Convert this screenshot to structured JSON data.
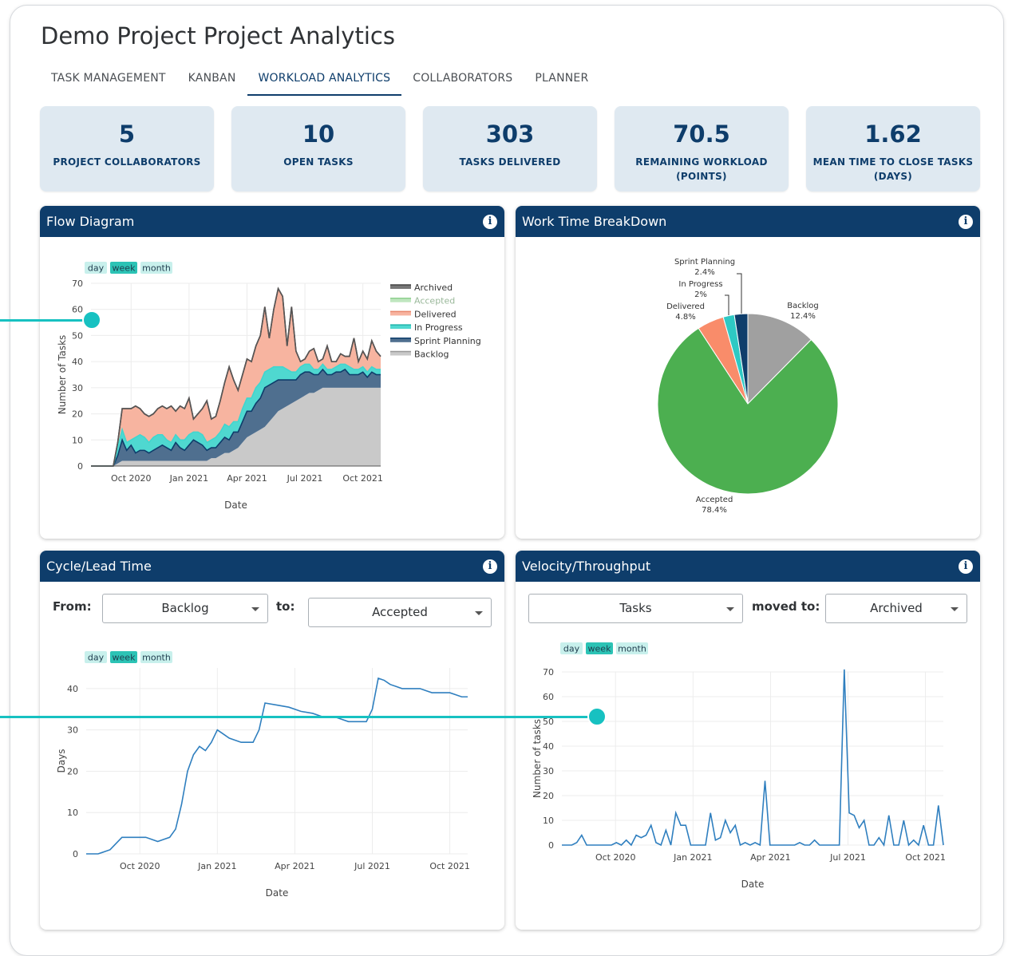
{
  "page": {
    "title": "Demo Project Project Analytics"
  },
  "tabs": [
    {
      "label": "TASK MANAGEMENT",
      "active": false
    },
    {
      "label": "KANBAN",
      "active": false
    },
    {
      "label": "WORKLOAD ANALYTICS",
      "active": true
    },
    {
      "label": "COLLABORATORS",
      "active": false
    },
    {
      "label": "PLANNER",
      "active": false
    }
  ],
  "kpis": [
    {
      "value": "5",
      "label_line1": "PROJECT COLLABORATORS",
      "label_line2": ""
    },
    {
      "value": "10",
      "label_line1": "OPEN TASKS",
      "label_line2": ""
    },
    {
      "value": "303",
      "label_line1": "TASKS DELIVERED",
      "label_line2": ""
    },
    {
      "value": "70.5",
      "label_line1": "REMAINING WORKLOAD",
      "label_line2": "(POINTS)"
    },
    {
      "value": "1.62",
      "label_line1": "MEAN TIME TO CLOSE TASKS",
      "label_line2": "(DAYS)"
    }
  ],
  "colors": {
    "brand": "#0e3d6b",
    "kpi_bg": "#dfe9f1",
    "line": "#2f7fbf",
    "overlay": "#17c1c1",
    "archived": "#555555",
    "accepted": "#4caf50",
    "delivered": "#f9a58e",
    "in_progress": "#40d6cf",
    "sprint_planning": "#0e3d6b",
    "backlog": "#c8c8c8"
  },
  "range_buttons": [
    "day",
    "week",
    "month"
  ],
  "panels": {
    "flow": {
      "title": "Flow Diagram",
      "info": "i"
    },
    "work": {
      "title": "Work Time BreakDown",
      "info": "i"
    },
    "cycle": {
      "title": "Cycle/Lead Time",
      "info": "i",
      "from_label": "From:",
      "from_value": "Backlog",
      "to_label": "to:",
      "to_value": "Accepted"
    },
    "velocity": {
      "title": "Velocity/Throughput",
      "info": "i",
      "metric_value": "Tasks",
      "moved_label": "moved to:",
      "moved_value": "Archived"
    }
  },
  "chart_data": [
    {
      "id": "flow",
      "type": "area",
      "xlabel": "Date",
      "ylabel": "Number of Tasks",
      "ylim": [
        0,
        70
      ],
      "yticks": [
        0,
        10,
        20,
        30,
        40,
        50,
        60,
        70
      ],
      "xticks": [
        "Oct 2020",
        "Jan 2021",
        "Apr 2021",
        "Jul 2021",
        "Oct 2021"
      ],
      "xtick_weeks": [
        9,
        22,
        35,
        48,
        61
      ],
      "range_selected": "week",
      "legend": [
        "Archived",
        "Accepted",
        "Delivered",
        "In Progress",
        "Sprint Planning",
        "Backlog"
      ],
      "legend_position": "right",
      "series": [
        {
          "name": "Backlog",
          "values": [
            0,
            0,
            0,
            0,
            0,
            0,
            1,
            2,
            2,
            2,
            2,
            2,
            2,
            2,
            2,
            2,
            2,
            2,
            2,
            2,
            2,
            2,
            2,
            2,
            2,
            2,
            2,
            3,
            3,
            4,
            5,
            5,
            6,
            7,
            9,
            11,
            12,
            13,
            14,
            15,
            17,
            19,
            21,
            22,
            23,
            24,
            25,
            26,
            27,
            28,
            28,
            29,
            30,
            30,
            30,
            30,
            30,
            30,
            30,
            30,
            30,
            30,
            30,
            30,
            30,
            30
          ]
        },
        {
          "name": "Sprint Planning",
          "values": [
            0,
            0,
            0,
            0,
            0,
            0,
            3,
            8,
            4,
            6,
            3,
            4,
            4,
            3,
            4,
            5,
            6,
            5,
            4,
            7,
            5,
            4,
            6,
            8,
            7,
            6,
            4,
            4,
            4,
            5,
            6,
            5,
            7,
            6,
            8,
            10,
            9,
            11,
            12,
            15,
            14,
            13,
            12,
            11,
            10,
            9,
            8,
            9,
            9,
            8,
            7,
            6,
            7,
            5,
            5,
            6,
            6,
            7,
            5,
            5,
            5,
            6,
            4,
            6,
            5,
            5
          ]
        },
        {
          "name": "In Progress",
          "values": [
            0,
            0,
            0,
            0,
            0,
            0,
            3,
            4,
            3,
            2,
            6,
            6,
            5,
            4,
            5,
            5,
            4,
            3,
            3,
            3,
            3,
            4,
            4,
            3,
            4,
            4,
            3,
            3,
            4,
            4,
            5,
            5,
            4,
            4,
            5,
            5,
            5,
            6,
            6,
            6,
            6,
            6,
            5,
            5,
            4,
            3,
            3,
            3,
            3,
            3,
            2,
            2,
            2,
            2,
            2,
            2,
            3,
            2,
            3,
            2,
            2,
            2,
            2,
            2,
            2,
            2
          ]
        },
        {
          "name": "Accepted",
          "values": [
            0,
            0,
            0,
            0,
            0,
            0,
            0,
            0,
            0,
            0,
            0,
            0,
            0,
            0,
            0,
            0,
            0,
            0,
            0,
            0,
            0,
            0,
            0,
            0,
            0,
            0,
            0,
            0,
            0,
            0,
            0,
            0,
            0,
            0,
            0,
            0,
            0,
            0,
            0,
            0,
            0,
            0,
            0,
            0,
            0,
            0,
            0,
            0,
            0,
            0,
            0,
            0,
            0,
            0,
            0,
            0,
            0,
            0,
            0,
            0,
            0,
            0,
            0,
            0,
            0,
            0
          ]
        },
        {
          "name": "Delivered",
          "values": [
            0,
            0,
            0,
            0,
            0,
            0,
            2,
            8,
            13,
            12,
            12,
            10,
            9,
            10,
            9,
            10,
            11,
            12,
            14,
            9,
            13,
            12,
            14,
            5,
            7,
            10,
            16,
            8,
            8,
            12,
            16,
            23,
            16,
            12,
            13,
            15,
            14,
            16,
            18,
            25,
            12,
            22,
            30,
            27,
            9,
            25,
            8,
            2,
            2,
            5,
            8,
            3,
            2,
            9,
            3,
            2,
            4,
            3,
            4,
            12,
            3,
            6,
            5,
            10,
            7,
            5
          ]
        },
        {
          "name": "Archived",
          "values": [
            0,
            0,
            0,
            0,
            0,
            0,
            0,
            0,
            0,
            0,
            0,
            0,
            0,
            0,
            0,
            0,
            0,
            0,
            0,
            0,
            0,
            0,
            0,
            0,
            0,
            0,
            0,
            0,
            0,
            0,
            0,
            0,
            0,
            0,
            0,
            0,
            0,
            0,
            0,
            0,
            0,
            0,
            0,
            0,
            0,
            0,
            0,
            0,
            0,
            0,
            0,
            0,
            0,
            0,
            0,
            0,
            0,
            0,
            0,
            0,
            0,
            0,
            0,
            0,
            0,
            0
          ]
        }
      ]
    },
    {
      "id": "work",
      "type": "pie",
      "slices": [
        {
          "name": "Backlog",
          "value": 12.4,
          "label": "12.4%"
        },
        {
          "name": "Accepted",
          "value": 78.4,
          "label": "78.4%"
        },
        {
          "name": "Delivered",
          "value": 4.8,
          "label": "4.8%"
        },
        {
          "name": "In Progress",
          "value": 2,
          "label": "2%"
        },
        {
          "name": "Sprint Planning",
          "value": 2.4,
          "label": "2.4%"
        }
      ]
    },
    {
      "id": "cycle",
      "type": "line",
      "xlabel": "Date",
      "ylabel": "Days",
      "ylim": [
        0,
        45
      ],
      "yticks": [
        0,
        10,
        20,
        30,
        40
      ],
      "xticks": [
        "Oct 2020",
        "Jan 2021",
        "Apr 2021",
        "Jul 2021",
        "Oct 2021"
      ],
      "xtick_weeks": [
        9,
        22,
        35,
        48,
        61
      ],
      "range_selected": "week",
      "x": [
        0,
        2,
        4,
        6,
        8,
        10,
        11,
        12,
        13,
        14,
        15,
        16,
        17,
        18,
        19,
        20,
        21,
        22,
        23,
        24,
        25,
        26,
        27,
        28,
        29,
        30,
        32,
        34,
        36,
        38,
        40,
        42,
        44,
        46,
        47,
        48,
        49,
        50,
        51,
        52,
        53,
        54,
        55,
        56,
        57,
        58,
        59,
        60,
        61,
        62,
        63,
        64
      ],
      "values": [
        0,
        0,
        1,
        4,
        4,
        4,
        3.5,
        3,
        3.5,
        4,
        6,
        12,
        20,
        24,
        26,
        25,
        27,
        30,
        29,
        28,
        27.5,
        27,
        27,
        27,
        30,
        36.5,
        36,
        35.5,
        34.5,
        34,
        33,
        33,
        32,
        32,
        32,
        35,
        42.5,
        42,
        41,
        40.5,
        40,
        40,
        40,
        40,
        39.5,
        39,
        39,
        39,
        39,
        38.5,
        38,
        38
      ]
    },
    {
      "id": "velocity",
      "type": "line",
      "xlabel": "Date",
      "ylabel": "Number of tasks",
      "ylim": [
        0,
        70
      ],
      "yticks": [
        0,
        10,
        20,
        30,
        40,
        50,
        60,
        70
      ],
      "xticks": [
        "Oct 2020",
        "Jan 2021",
        "Apr 2021",
        "Jul 2021",
        "Oct 2021"
      ],
      "xtick_weeks": [
        9,
        22,
        35,
        48,
        61
      ],
      "range_selected": "week",
      "values": [
        0,
        0,
        0,
        1,
        4,
        0,
        0,
        0,
        0,
        0,
        0,
        1,
        0,
        2,
        0,
        4,
        3,
        4,
        8,
        1,
        0,
        6,
        0,
        13,
        8,
        8,
        0,
        0,
        0,
        0,
        13,
        2,
        3,
        10,
        5,
        8,
        0,
        1,
        0,
        1,
        0,
        26,
        0,
        0,
        0,
        0,
        0,
        0,
        1,
        0,
        0,
        2,
        0,
        0,
        0,
        0,
        0,
        71,
        13,
        12,
        7,
        10,
        0,
        0,
        3,
        0,
        12,
        0,
        0,
        10,
        0,
        2,
        0,
        8,
        0,
        0,
        16,
        0
      ]
    }
  ]
}
